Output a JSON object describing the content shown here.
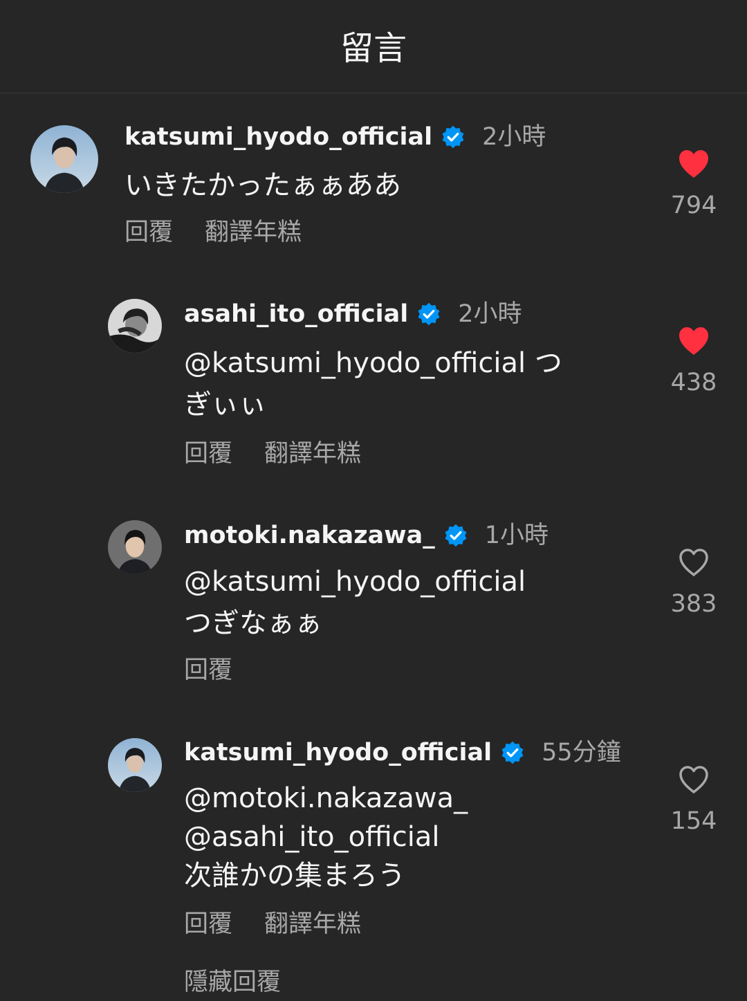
{
  "header": {
    "title": "留言"
  },
  "comments": [
    {
      "username": "katsumi_hyodo_official",
      "verified": true,
      "time": "2小時",
      "text": [
        "いきたかったぁぁああ"
      ],
      "reply_label": "回覆",
      "translate_label": "翻譯年糕",
      "likes": "794",
      "liked": true
    },
    {
      "username": "asahi_ito_official",
      "verified": true,
      "time": "2小時",
      "text": [
        "@katsumi_hyodo_official つ",
        "ぎぃぃ"
      ],
      "reply_label": "回覆",
      "translate_label": "翻譯年糕",
      "likes": "438",
      "liked": true
    },
    {
      "username": "motoki.nakazawa_",
      "verified": true,
      "time": "1小時",
      "text": [
        "@katsumi_hyodo_official",
        "つぎなぁぁ"
      ],
      "reply_label": "回覆",
      "likes": "383",
      "liked": false
    },
    {
      "username": "katsumi_hyodo_official",
      "verified": true,
      "time": "55分鐘",
      "text": [
        "@motoki.nakazawa_",
        "@asahi_ito_official",
        "次誰かの集まろう"
      ],
      "reply_label": "回覆",
      "translate_label": "翻譯年糕",
      "likes": "154",
      "liked": false
    }
  ],
  "hide_replies_label": "隱藏回覆",
  "colors": {
    "background": "#262626",
    "like_red": "#ff3040",
    "verified_blue": "#0095f6",
    "secondary_text": "#a8a8a8"
  }
}
